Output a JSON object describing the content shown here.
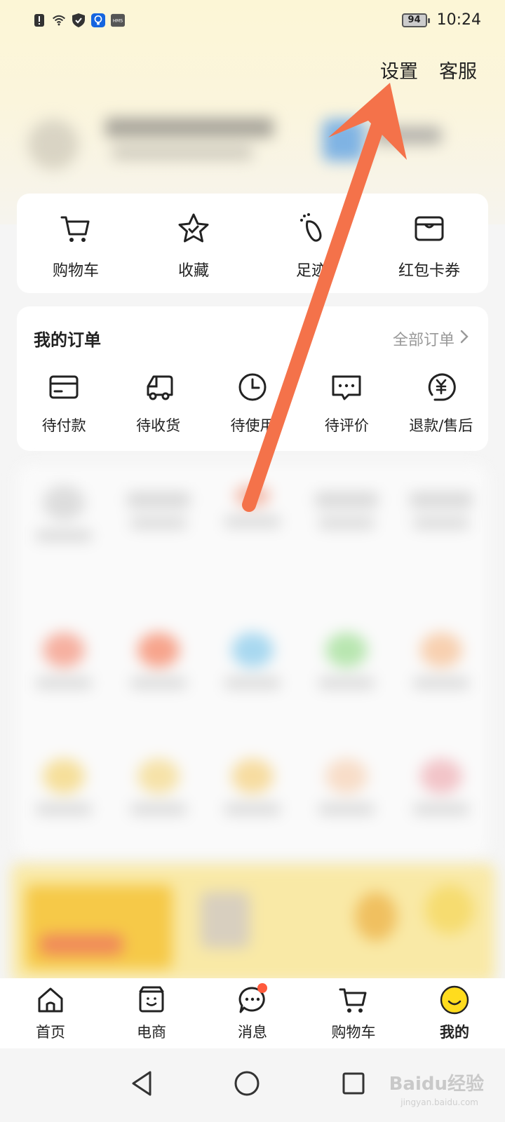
{
  "status_bar": {
    "battery": "94",
    "time": "10:24",
    "icons": [
      "alert-icon",
      "wifi-icon",
      "shield-icon",
      "bulb-icon",
      "hms-icon"
    ]
  },
  "top_links": {
    "settings": "设置",
    "service": "客服"
  },
  "quick_actions": [
    {
      "label": "购物车",
      "icon": "cart-icon"
    },
    {
      "label": "收藏",
      "icon": "star-icon"
    },
    {
      "label": "足迹",
      "icon": "footprint-icon"
    },
    {
      "label": "红包卡券",
      "icon": "wallet-icon"
    }
  ],
  "orders": {
    "title": "我的订单",
    "all_label": "全部订单",
    "items": [
      {
        "label": "待付款",
        "icon": "card-icon"
      },
      {
        "label": "待收货",
        "icon": "truck-icon"
      },
      {
        "label": "待使用",
        "icon": "clock-icon"
      },
      {
        "label": "待评价",
        "icon": "comment-icon"
      },
      {
        "label": "退款/售后",
        "icon": "refund-icon"
      }
    ]
  },
  "bottom_nav": [
    {
      "label": "首页",
      "icon": "home-icon"
    },
    {
      "label": "电商",
      "icon": "shop-icon"
    },
    {
      "label": "消息",
      "icon": "message-icon"
    },
    {
      "label": "购物车",
      "icon": "cart-icon"
    },
    {
      "label": "我的",
      "icon": "smile-icon",
      "active": true
    }
  ],
  "watermark": {
    "text": "Baidu经验",
    "sub": "jingyan.baidu.com"
  },
  "colors": {
    "arrow": "#f4724a",
    "accent": "#ffd700",
    "badge": "#ff5a3c"
  }
}
